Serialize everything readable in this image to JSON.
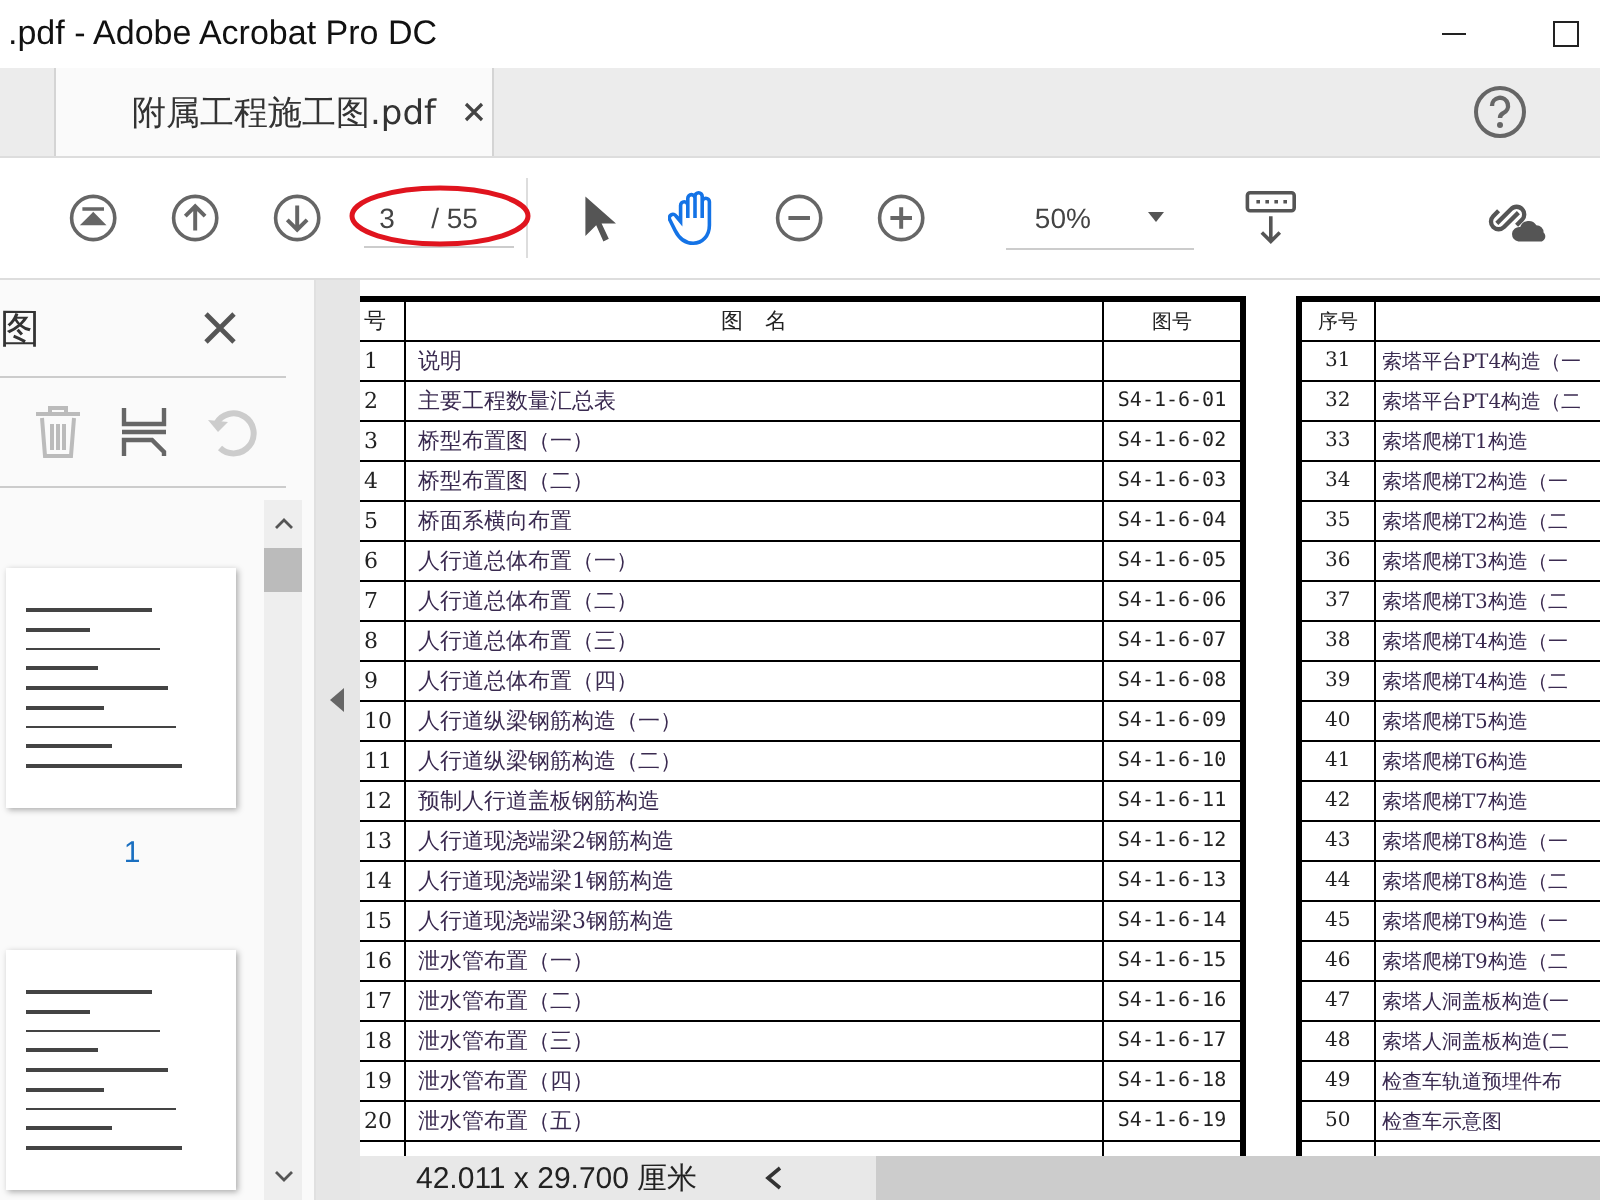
{
  "window": {
    "title": ".pdf - Adobe Acrobat Pro DC"
  },
  "tabs": [
    {
      "label": "附属工程施工图.pdf",
      "selected": true
    }
  ],
  "toolbar": {
    "page_current": "3",
    "page_total": "/ 55",
    "zoom": "50%",
    "hand_tool_selected": true
  },
  "sidebar": {
    "title": "图",
    "thumbnails": [
      {
        "kind": "page",
        "page_label": "1"
      },
      {
        "kind": "page"
      }
    ]
  },
  "tables": [
    {
      "columns": [
        "号",
        "图　名",
        "图号"
      ],
      "rows": [
        {
          "no": "1",
          "name": "说明"
        },
        {
          "no": "2",
          "name": "主要工程数量汇总表",
          "code": "S4-1-6-01"
        },
        {
          "no": "3",
          "name": "桥型布置图（一）",
          "code": "S4-1-6-02"
        },
        {
          "no": "4",
          "name": "桥型布置图（二）",
          "code": "S4-1-6-03"
        },
        {
          "no": "5",
          "name": "桥面系横向布置",
          "code": "S4-1-6-04"
        },
        {
          "no": "6",
          "name": "人行道总体布置（一）",
          "code": "S4-1-6-05"
        },
        {
          "no": "7",
          "name": "人行道总体布置（二）",
          "code": "S4-1-6-06"
        },
        {
          "no": "8",
          "name": "人行道总体布置（三）",
          "code": "S4-1-6-07"
        },
        {
          "no": "9",
          "name": "人行道总体布置（四）",
          "code": "S4-1-6-08"
        },
        {
          "no": "10",
          "name": "人行道纵梁钢筋构造（一）",
          "code": "S4-1-6-09"
        },
        {
          "no": "11",
          "name": "人行道纵梁钢筋构造（二）",
          "code": "S4-1-6-10"
        },
        {
          "no": "12",
          "name": "预制人行道盖板钢筋构造",
          "code": "S4-1-6-11"
        },
        {
          "no": "13",
          "name": "人行道现浇端梁2钢筋构造",
          "code": "S4-1-6-12"
        },
        {
          "no": "14",
          "name": "人行道现浇端梁1钢筋构造",
          "code": "S4-1-6-13"
        },
        {
          "no": "15",
          "name": "人行道现浇端梁3钢筋构造",
          "code": "S4-1-6-14"
        },
        {
          "no": "16",
          "name": "泄水管布置（一）",
          "code": "S4-1-6-15"
        },
        {
          "no": "17",
          "name": "泄水管布置（二）",
          "code": "S4-1-6-16"
        },
        {
          "no": "18",
          "name": "泄水管布置（三）",
          "code": "S4-1-6-17"
        },
        {
          "no": "19",
          "name": "泄水管布置（四）",
          "code": "S4-1-6-18"
        },
        {
          "no": "20",
          "name": "泄水管布置（五）",
          "code": "S4-1-6-19"
        }
      ]
    },
    {
      "columns": [
        "序号"
      ],
      "rows": [
        {
          "no": "31",
          "name": "索塔平台PT4构造（一"
        },
        {
          "no": "32",
          "name": "索塔平台PT4构造（二"
        },
        {
          "no": "33",
          "name": "索塔爬梯T1构造"
        },
        {
          "no": "34",
          "name": "索塔爬梯T2构造（一"
        },
        {
          "no": "35",
          "name": "索塔爬梯T2构造（二"
        },
        {
          "no": "36",
          "name": "索塔爬梯T3构造（一"
        },
        {
          "no": "37",
          "name": "索塔爬梯T3构造（二"
        },
        {
          "no": "38",
          "name": "索塔爬梯T4构造（一"
        },
        {
          "no": "39",
          "name": "索塔爬梯T4构造（二"
        },
        {
          "no": "40",
          "name": "索塔爬梯T5构造"
        },
        {
          "no": "41",
          "name": "索塔爬梯T6构造"
        },
        {
          "no": "42",
          "name": "索塔爬梯T7构造"
        },
        {
          "no": "43",
          "name": "索塔爬梯T8构造（一"
        },
        {
          "no": "44",
          "name": "索塔爬梯T8构造（二"
        },
        {
          "no": "45",
          "name": "索塔爬梯T9构造（一"
        },
        {
          "no": "46",
          "name": "索塔爬梯T9构造（二"
        },
        {
          "no": "47",
          "name": "索塔人洞盖板构造(一"
        },
        {
          "no": "48",
          "name": "索塔人洞盖板构造(二"
        },
        {
          "no": "49",
          "name": "检查车轨道预埋件布"
        },
        {
          "no": "50",
          "name": "检查车示意图"
        }
      ]
    }
  ],
  "status_bar": {
    "page_size": "42.011 x 29.700 厘米"
  }
}
